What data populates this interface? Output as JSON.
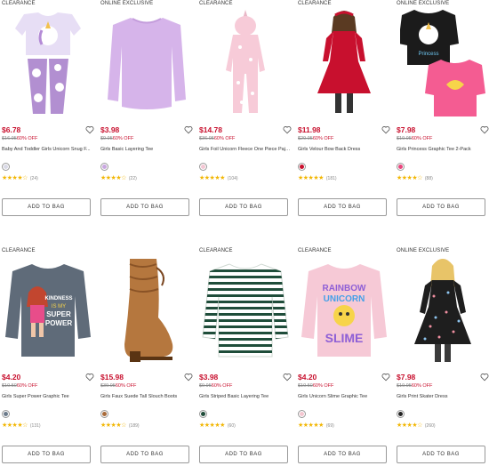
{
  "products": [
    {
      "badge": "CLEARANCE",
      "price": "$6.78",
      "was": "$16.95",
      "off": "60% OFF",
      "name": "Baby And Toddler Girls Unicorn Snug F...",
      "swatch_color": "#d9d9e6",
      "rating": 4,
      "reviews": "(24)",
      "cta": "ADD TO BAG",
      "icon": "unicorn-pajamas"
    },
    {
      "badge": "ONLINE EXCLUSIVE",
      "price": "$3.98",
      "was": "$9.95",
      "off": "60% OFF",
      "name": "Girls Basic Layering Tee",
      "swatch_color": "#c9a7e0",
      "rating": 4,
      "reviews": "(22)",
      "cta": "ADD TO BAG",
      "icon": "lavender-tee"
    },
    {
      "badge": "CLEARANCE",
      "price": "$14.78",
      "was": "$36.95",
      "off": "60% OFF",
      "name": "Girls Foil Unicorn Fleece One Piece Paja...",
      "swatch_color": "#f3c6d3",
      "rating": 5,
      "reviews": "(104)",
      "cta": "ADD TO BAG",
      "icon": "unicorn-onesie"
    },
    {
      "badge": "CLEARANCE",
      "price": "$11.98",
      "was": "$29.95",
      "off": "60% OFF",
      "name": "Girls Velour Bow Back Dress",
      "swatch_color": "#c8102e",
      "rating": 5,
      "reviews": "(181)",
      "cta": "ADD TO BAG",
      "icon": "red-dress"
    },
    {
      "badge": "ONLINE EXCLUSIVE",
      "price": "$7.98",
      "was": "$19.95",
      "off": "60% OFF",
      "name": "Girls Princess Graphic Tee 2-Pack",
      "swatch_color": "#e8457d",
      "rating": 4,
      "reviews": "(88)",
      "cta": "ADD TO BAG",
      "icon": "tee-2pack"
    },
    {
      "badge": "CLEARANCE",
      "price": "$4.20",
      "was": "$10.50",
      "off": "60% OFF",
      "name": "Girls Super Power Graphic Tee",
      "swatch_color": "#6b7a8a",
      "rating": 4,
      "reviews": "(131)",
      "cta": "ADD TO BAG",
      "icon": "grey-graphic-tee",
      "tee_text": [
        "KINDNESS",
        "IS MY",
        "SUPER",
        "POWER"
      ]
    },
    {
      "badge": "",
      "price": "$15.98",
      "was": "$39.95",
      "off": "60% OFF",
      "name": "Girls Faux Suede Tall Slouch Boots",
      "swatch_color": "#a86a3a",
      "rating": 4,
      "reviews": "(189)",
      "cta": "ADD TO BAG",
      "icon": "brown-boot"
    },
    {
      "badge": "CLEARANCE",
      "price": "$3.98",
      "was": "$9.95",
      "off": "60% OFF",
      "name": "Girls Striped Basic Layering Tee",
      "swatch_color": "#1f4d3a",
      "rating": 5,
      "reviews": "(60)",
      "cta": "ADD TO BAG",
      "icon": "striped-tee"
    },
    {
      "badge": "CLEARANCE",
      "price": "$4.20",
      "was": "$10.50",
      "off": "60% OFF",
      "name": "Girls Unicorn Slime Graphic Tee",
      "swatch_color": "#f4c6d0",
      "rating": 5,
      "reviews": "(69)",
      "cta": "ADD TO BAG",
      "icon": "slime-tee",
      "tee_text": [
        "RAINBOW",
        "UNICORN",
        "SLIME"
      ]
    },
    {
      "badge": "ONLINE EXCLUSIVE",
      "price": "$7.98",
      "was": "$19.95",
      "off": "60% OFF",
      "name": "Girls Print Skater Dress",
      "swatch_color": "#222222",
      "rating": 4,
      "reviews": "(260)",
      "cta": "ADD TO BAG",
      "icon": "print-dress"
    }
  ]
}
